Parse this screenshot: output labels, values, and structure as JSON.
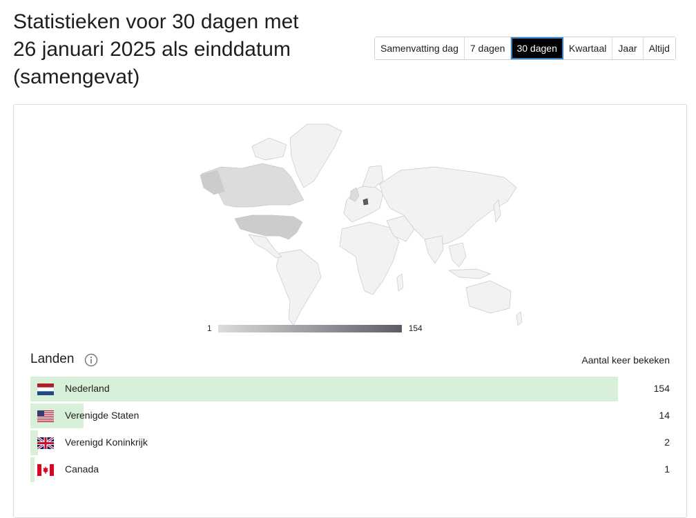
{
  "page": {
    "title": "Statistieken voor 30 dagen met 26 januari 2025 als einddatum (samengevat)"
  },
  "ranges": [
    {
      "label": "Samenvatting dag",
      "active": false
    },
    {
      "label": "7 dagen",
      "active": false
    },
    {
      "label": "30 dagen",
      "active": true
    },
    {
      "label": "Kwartaal",
      "active": false
    },
    {
      "label": "Jaar",
      "active": false
    },
    {
      "label": "Altijd",
      "active": false
    }
  ],
  "map": {
    "legend_min": "1",
    "legend_max": "154",
    "colors": {
      "empty": "#f2f2f2",
      "low": "#dcdcdc",
      "mid": "#cccccc",
      "high": "#5c5c66",
      "border": "#c8c8c8"
    }
  },
  "countries": {
    "title": "Landen",
    "views_header": "Aantal keer bekeken",
    "bar_color": "#d8f0d9",
    "max": 154,
    "items": [
      {
        "name": "Nederland",
        "views": 154,
        "flag": "nl-flag-icon"
      },
      {
        "name": "Verenigde Staten",
        "views": 14,
        "flag": "us-flag-icon"
      },
      {
        "name": "Verenigd Koninkrijk",
        "views": 2,
        "flag": "uk-flag-icon"
      },
      {
        "name": "Canada",
        "views": 1,
        "flag": "ca-flag-icon"
      }
    ]
  }
}
